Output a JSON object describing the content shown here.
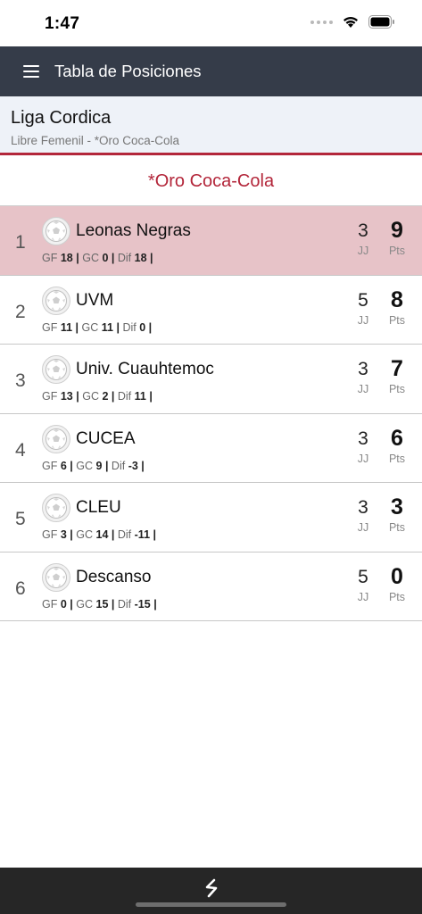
{
  "status": {
    "time": "1:47"
  },
  "nav": {
    "title": "Tabla de Posiciones"
  },
  "league": {
    "name": "Liga Cordica",
    "subtitle": "Libre Femenil - *Oro Coca-Cola"
  },
  "group": {
    "title": "*Oro Coca-Cola"
  },
  "labels": {
    "gf": "GF",
    "gc": "GC",
    "dif": "Dif",
    "jj": "JJ",
    "pts": "Pts",
    "sep": "|"
  },
  "colors": {
    "nav_bg": "#353c49",
    "accent": "#b3263a",
    "highlight_row": "#e7c3c8",
    "header_bg": "#eef2f8"
  },
  "icons": {
    "menu": "hamburger-menu-icon",
    "team": "soccer-ball-icon",
    "wifi": "wifi-icon",
    "battery": "battery-icon",
    "app": "app-logo-icon"
  },
  "standings": [
    {
      "pos": "1",
      "team": "Leonas Negras",
      "gf": "18",
      "gc": "0",
      "dif": "18",
      "jj": "3",
      "pts": "9"
    },
    {
      "pos": "2",
      "team": "UVM",
      "gf": "11",
      "gc": "11",
      "dif": "0",
      "jj": "5",
      "pts": "8"
    },
    {
      "pos": "3",
      "team": "Univ. Cuauhtemoc",
      "gf": "13",
      "gc": "2",
      "dif": "11",
      "jj": "3",
      "pts": "7"
    },
    {
      "pos": "4",
      "team": "CUCEA",
      "gf": "6",
      "gc": "9",
      "dif": "-3",
      "jj": "3",
      "pts": "6"
    },
    {
      "pos": "5",
      "team": "CLEU",
      "gf": "3",
      "gc": "14",
      "dif": "-11",
      "jj": "3",
      "pts": "3"
    },
    {
      "pos": "6",
      "team": "Descanso",
      "gf": "0",
      "gc": "15",
      "dif": "-15",
      "jj": "5",
      "pts": "0"
    }
  ]
}
